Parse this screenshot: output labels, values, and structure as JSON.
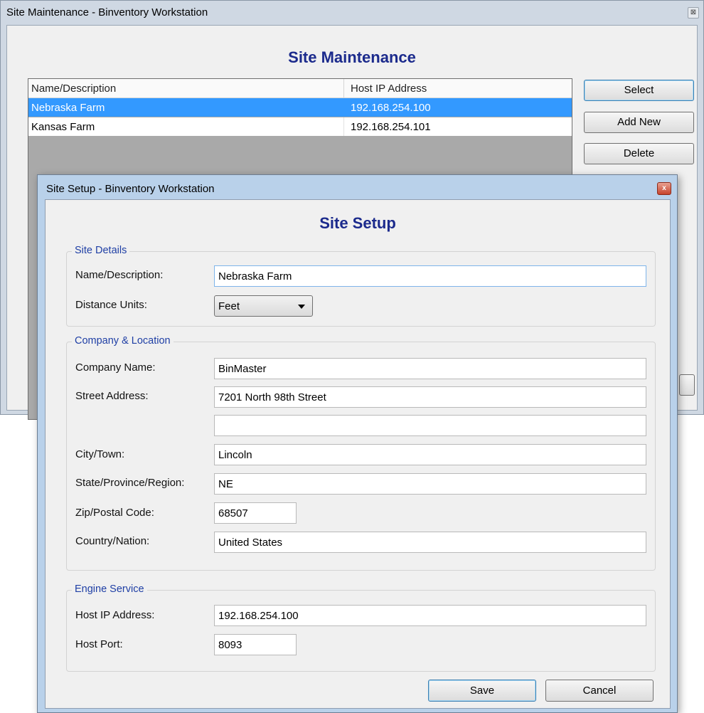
{
  "maintenance": {
    "window_title": "Site Maintenance - Binventory Workstation",
    "close_glyph": "⊠",
    "heading": "Site Maintenance",
    "columns": [
      "Name/Description",
      "Host IP Address"
    ],
    "rows": [
      {
        "name": "Nebraska Farm",
        "ip": "192.168.254.100",
        "selected": true
      },
      {
        "name": "Kansas Farm",
        "ip": "192.168.254.101",
        "selected": false
      }
    ],
    "buttons": {
      "select": "Select",
      "add_new": "Add New",
      "delete": "Delete"
    }
  },
  "setup": {
    "window_title": "Site Setup - Binventory Workstation",
    "close_glyph": "x",
    "heading": "Site Setup",
    "site_details": {
      "title": "Site Details",
      "name_label": "Name/Description:",
      "name_value": "Nebraska Farm",
      "units_label": "Distance Units:",
      "units_value": "Feet"
    },
    "company": {
      "title": "Company & Location",
      "company_label": "Company Name:",
      "company_value": "BinMaster",
      "street_label": "Street Address:",
      "street_value": "7201 North 98th Street",
      "street2_value": "",
      "city_label": "City/Town:",
      "city_value": "Lincoln",
      "state_label": "State/Province/Region:",
      "state_value": "NE",
      "zip_label": "Zip/Postal Code:",
      "zip_value": "68507",
      "country_label": "Country/Nation:",
      "country_value": "United States"
    },
    "engine": {
      "title": "Engine Service",
      "host_ip_label": "Host IP Address:",
      "host_ip_value": "192.168.254.100",
      "port_label": "Host Port:",
      "port_value": "8093"
    },
    "buttons": {
      "save": "Save",
      "cancel": "Cancel"
    }
  },
  "colors": {
    "heading": "#1b2a8c",
    "group_title": "#1f3fa5",
    "selection": "#3399ff",
    "window_frame": "#b9d1ea"
  }
}
